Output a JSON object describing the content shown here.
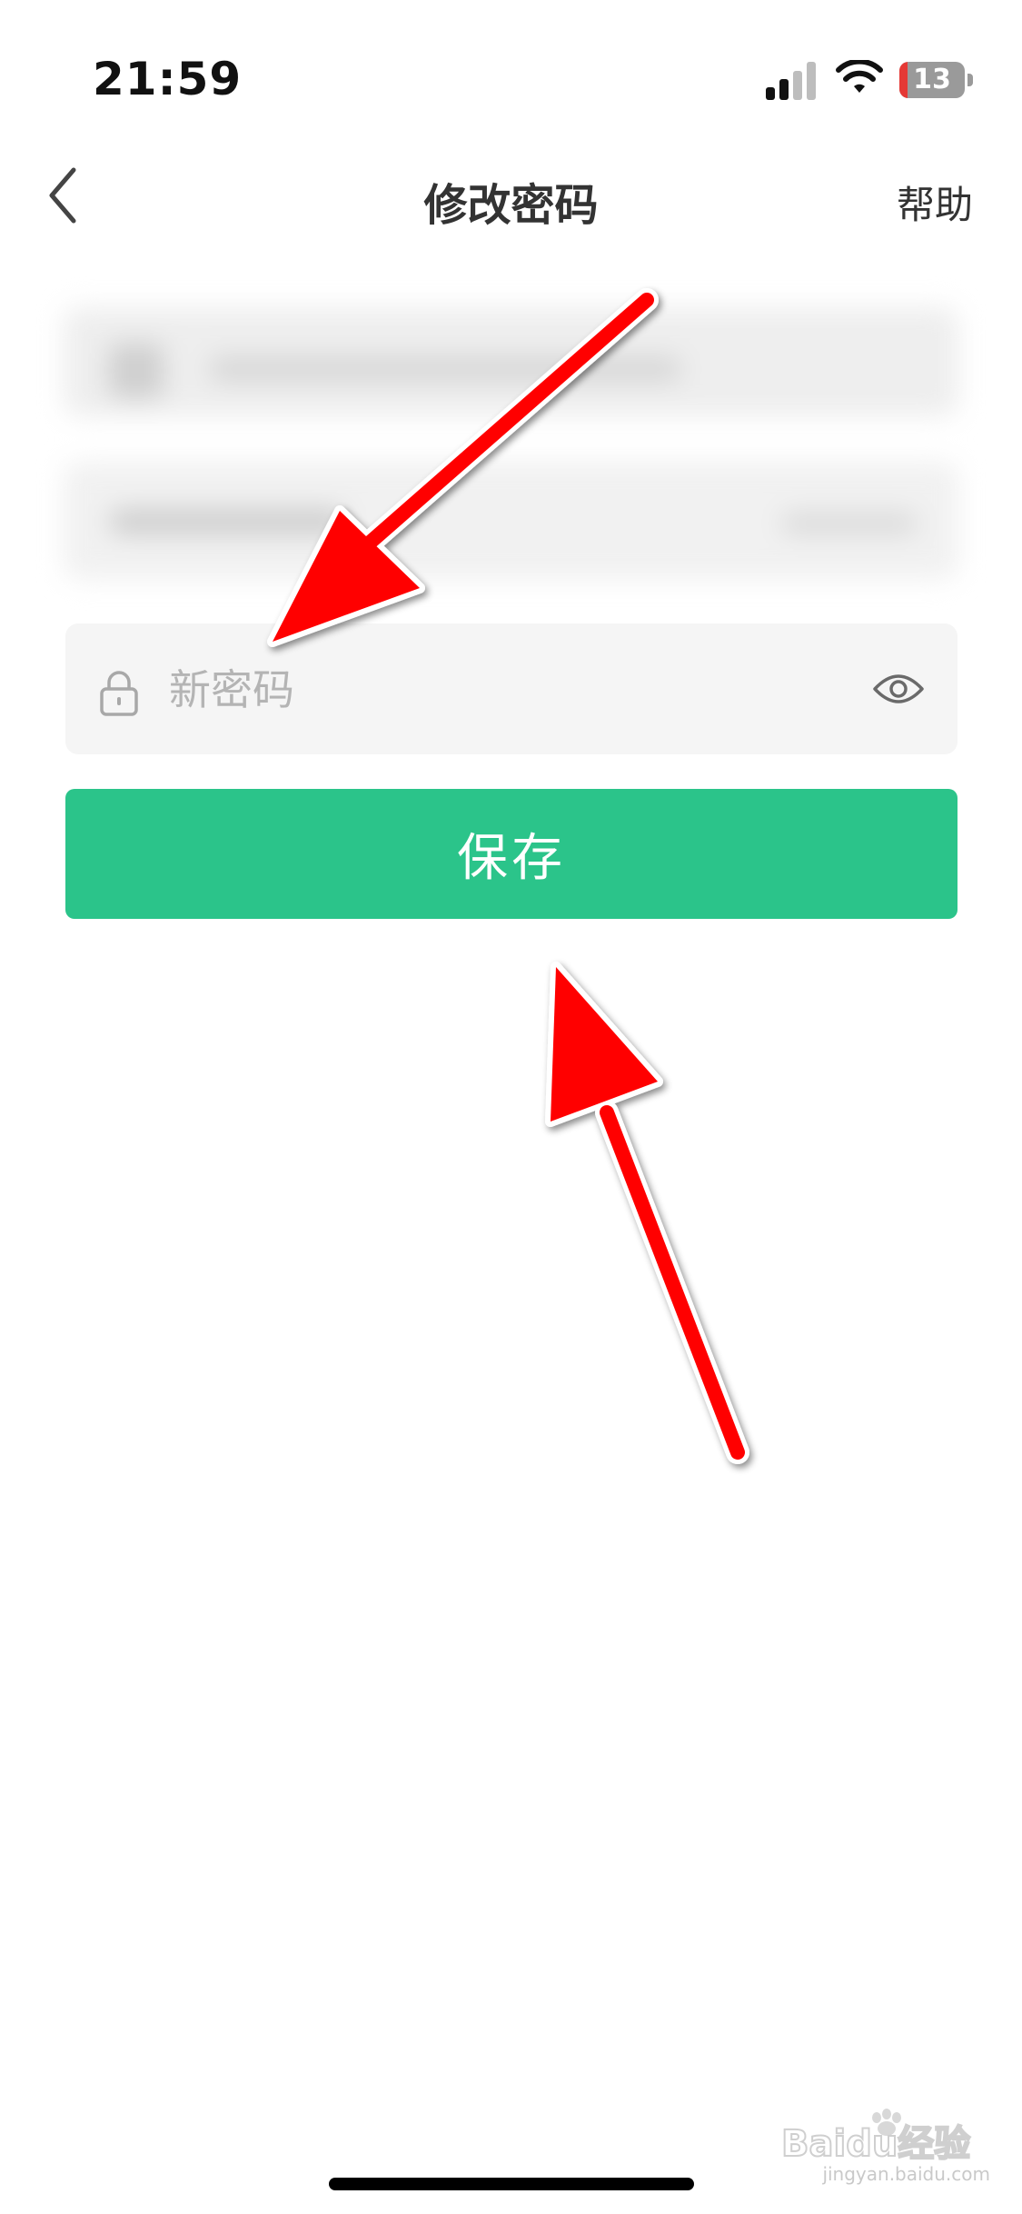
{
  "status_bar": {
    "time": "21:59",
    "battery_level": "13",
    "battery_fraction": 0.13,
    "battery_color": "#e53935"
  },
  "nav": {
    "title": "修改密码",
    "help_label": "帮助",
    "back_icon": "chevron-left-icon"
  },
  "form": {
    "password_placeholder": "新密码",
    "password_value": "",
    "lock_icon": "lock-icon",
    "visibility_icon": "eye-icon",
    "save_label": "保存"
  },
  "colors": {
    "accent": "#2bc48a",
    "field_bg": "#f5f5f5",
    "placeholder": "#b4b4b4",
    "annotation_arrow": "#ff0000"
  },
  "watermark": {
    "brand": "Baidu经验",
    "url": "jingyan.baidu.com"
  }
}
